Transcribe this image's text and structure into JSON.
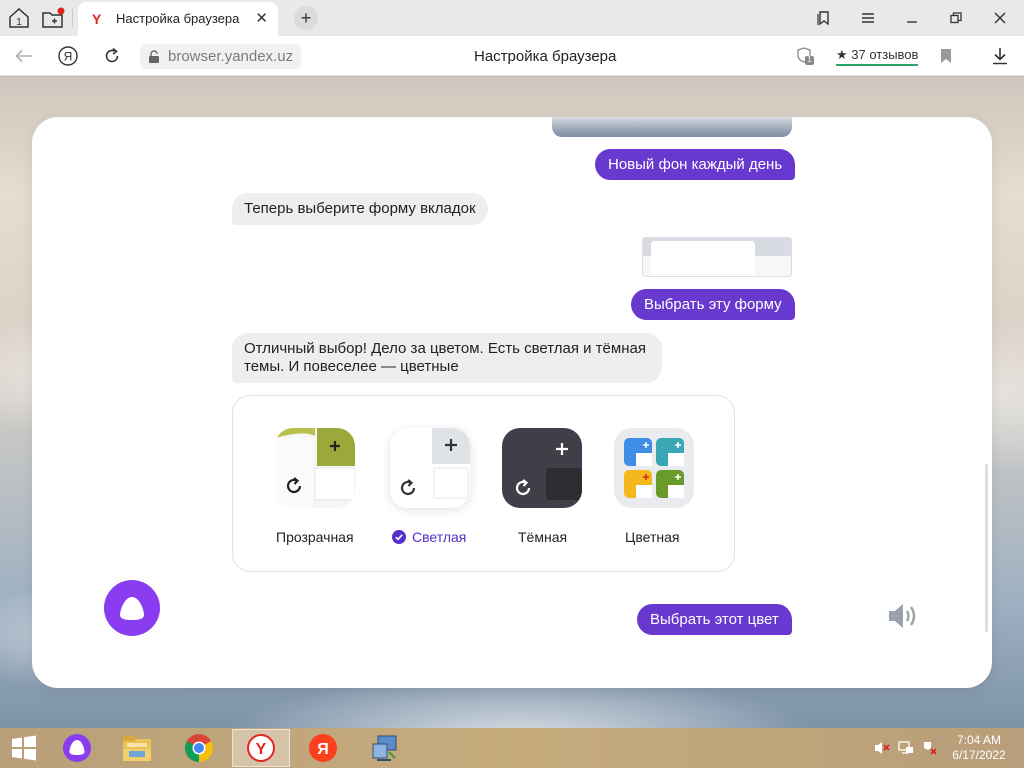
{
  "tabs": [
    {
      "title": "Настройка браузера",
      "favicon": "Y"
    }
  ],
  "address_bar": {
    "url": "browser.yandex.uz",
    "page_title": "Настройка браузера",
    "reviews": "★ 37 отзывов",
    "protect_badge": "1"
  },
  "chat": {
    "msg_user_1": "Новый фон каждый день",
    "msg_bot_1": "Теперь выберите форму вкладок",
    "msg_user_2": "Выбрать эту форму",
    "msg_bot_2": "Отличный выбор! Дело за цветом. Есть светлая и тёмная темы. И повеселее — цветные",
    "action_button": "Выбрать этот цвет"
  },
  "themes": [
    {
      "label": "Прозрачная",
      "selected": false
    },
    {
      "label": "Светлая",
      "selected": true
    },
    {
      "label": "Тёмная",
      "selected": false
    },
    {
      "label": "Цветная",
      "selected": false
    }
  ],
  "taskbar": {
    "time": "7:04 AM",
    "date": "6/17/2022"
  },
  "colors": {
    "accent": "#6839cf",
    "alice": "#8a3df0",
    "selected_check": "#5530c4"
  }
}
